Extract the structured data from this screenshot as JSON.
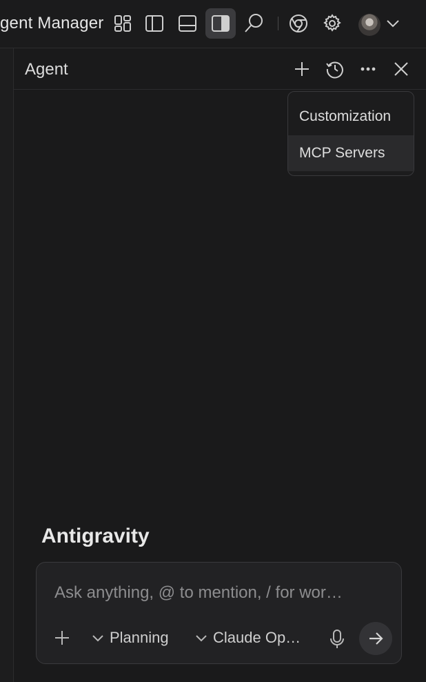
{
  "topbar": {
    "title_fragment": "gent Manager",
    "icons": [
      "layout-icon",
      "sidebar-left-icon",
      "panel-bottom-icon",
      "sidebar-right-icon",
      "search-icon",
      "chrome-icon",
      "gear-icon",
      "avatar",
      "chevron-down-icon"
    ]
  },
  "panel": {
    "title": "Agent",
    "actions": [
      "plus-icon",
      "history-icon",
      "more-icon",
      "close-icon"
    ]
  },
  "menu": {
    "items": [
      {
        "label": "Customization"
      },
      {
        "label": "MCP Servers"
      }
    ]
  },
  "brand": "Antigravity",
  "composer": {
    "placeholder": "Ask anything, @ to mention, / for wor…",
    "mode_label": "Planning",
    "model_label": "Claude Op…"
  },
  "colors": {
    "background": "#1a1a1b",
    "active_icon_bg": "#3b3b3e",
    "menu_highlight": "#2a2a2c"
  }
}
